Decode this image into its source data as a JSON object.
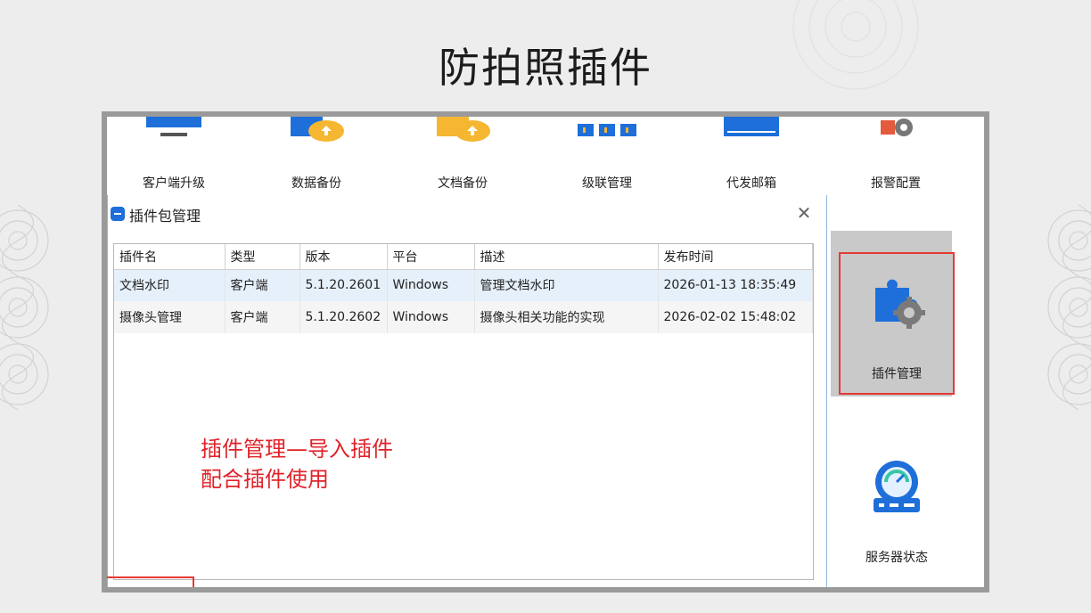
{
  "slide": {
    "title": "防拍照插件"
  },
  "toolbar": {
    "items": [
      {
        "label": "客户端升级",
        "icon": "monitor-icon"
      },
      {
        "label": "数据备份",
        "icon": "cloud-upload-folder-icon"
      },
      {
        "label": "文档备份",
        "icon": "cloud-upload-document-icon"
      },
      {
        "label": "级联管理",
        "icon": "cascade-network-icon"
      },
      {
        "label": "代发邮箱",
        "icon": "mail-folder-icon"
      },
      {
        "label": "报警配置",
        "icon": "alarm-gear-icon"
      }
    ]
  },
  "side_panel": {
    "plugin_manage": {
      "label": "插件管理",
      "icon": "puzzle-gear-icon"
    },
    "server_status": {
      "label": "服务器状态",
      "icon": "server-gauge-icon"
    }
  },
  "dialog": {
    "title": "插件包管理",
    "close_glyph": "✕",
    "columns": [
      "插件名",
      "类型",
      "版本",
      "平台",
      "描述",
      "发布时间"
    ],
    "rows": [
      [
        "文档水印",
        "客户端",
        "5.1.20.2601",
        "Windows",
        "管理文档水印",
        "2026-01-13 18:35:49"
      ],
      [
        "摄像头管理",
        "客户端",
        "5.1.20.2602",
        "Windows",
        "摄像头相关功能的实现",
        "2026-02-02 15:48:02"
      ]
    ]
  },
  "annotation": {
    "line1": "插件管理—导入插件",
    "line2": "配合插件使用",
    "color": "#e0232a"
  },
  "colors": {
    "accent": "#1e6fd9",
    "highlight_border": "#e53935",
    "selected_row": "#e6f0fa"
  }
}
